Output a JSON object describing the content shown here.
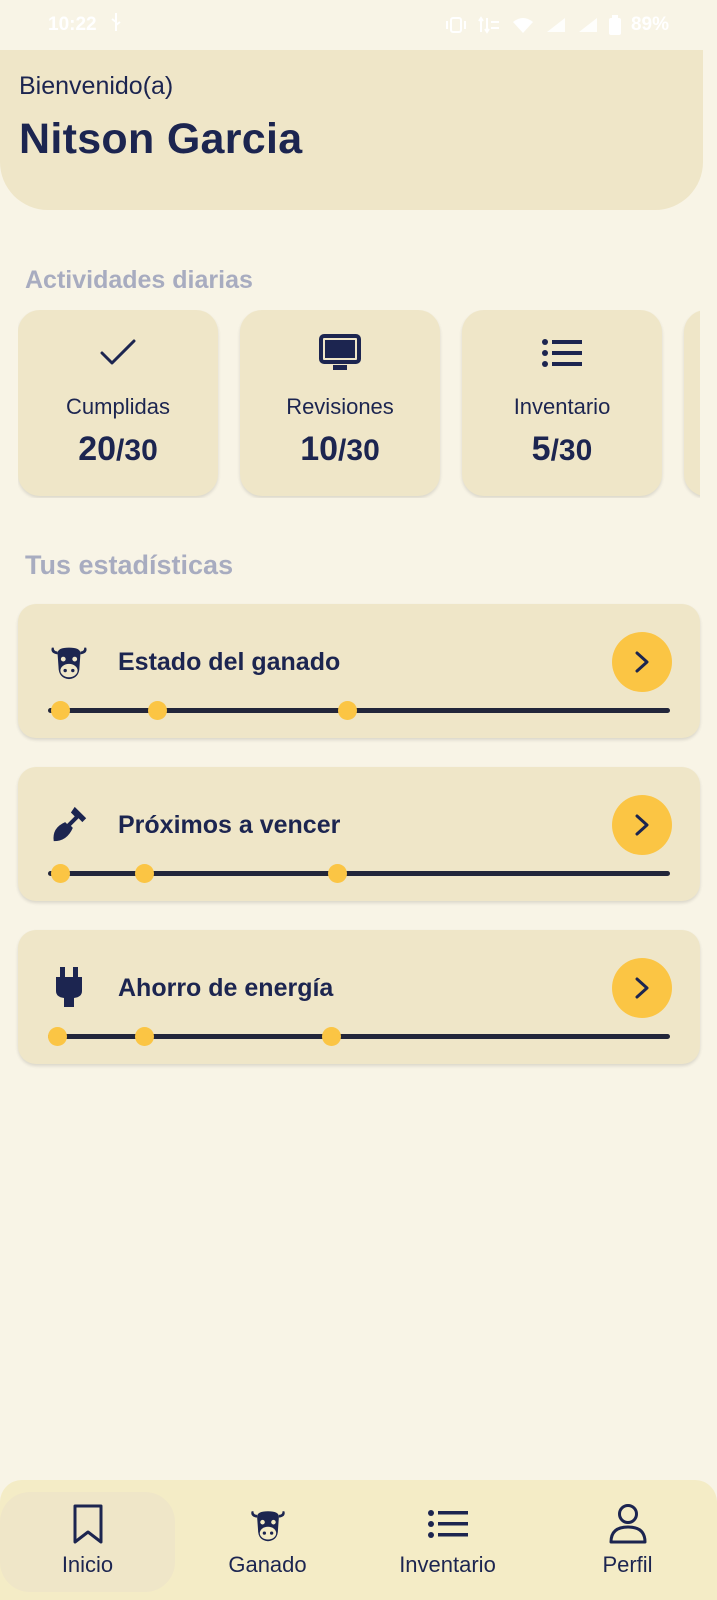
{
  "status_bar": {
    "time": "10:22",
    "battery": "89%"
  },
  "header": {
    "welcome": "Bienvenido(a)",
    "user_name": "Nitson Garcia"
  },
  "activities": {
    "title": "Actividades diarias",
    "items": [
      {
        "icon": "check-icon",
        "label": "Cumplidas",
        "done": "20",
        "total": "/30"
      },
      {
        "icon": "monitor-icon",
        "label": "Revisiones",
        "done": "10",
        "total": "/30"
      },
      {
        "icon": "list-icon",
        "label": "Inventario",
        "done": "5",
        "total": "/30"
      }
    ]
  },
  "stats": {
    "title": "Tus estadísticas",
    "items": [
      {
        "icon": "cow-icon",
        "label": "Estado del ganado",
        "markers": [
          0.02,
          0.175,
          0.48
        ]
      },
      {
        "icon": "shovel-icon",
        "label": "Próximos a vencer",
        "markers": [
          0.02,
          0.155,
          0.465
        ]
      },
      {
        "icon": "plug-icon",
        "label": "Ahorro de energía",
        "markers": [
          0.015,
          0.155,
          0.455
        ]
      }
    ]
  },
  "colors": {
    "background": "#f8f4e6",
    "card": "#efe6c8",
    "accent": "#fbc544",
    "text": "#1c2550",
    "muted": "#a8acc0"
  },
  "nav": {
    "items": [
      {
        "icon": "bookmark-icon",
        "label": "Inicio",
        "active": true
      },
      {
        "icon": "cow-icon",
        "label": "Ganado",
        "active": false
      },
      {
        "icon": "list-icon",
        "label": "Inventario",
        "active": false
      },
      {
        "icon": "person-icon",
        "label": "Perfil",
        "active": false
      }
    ]
  }
}
